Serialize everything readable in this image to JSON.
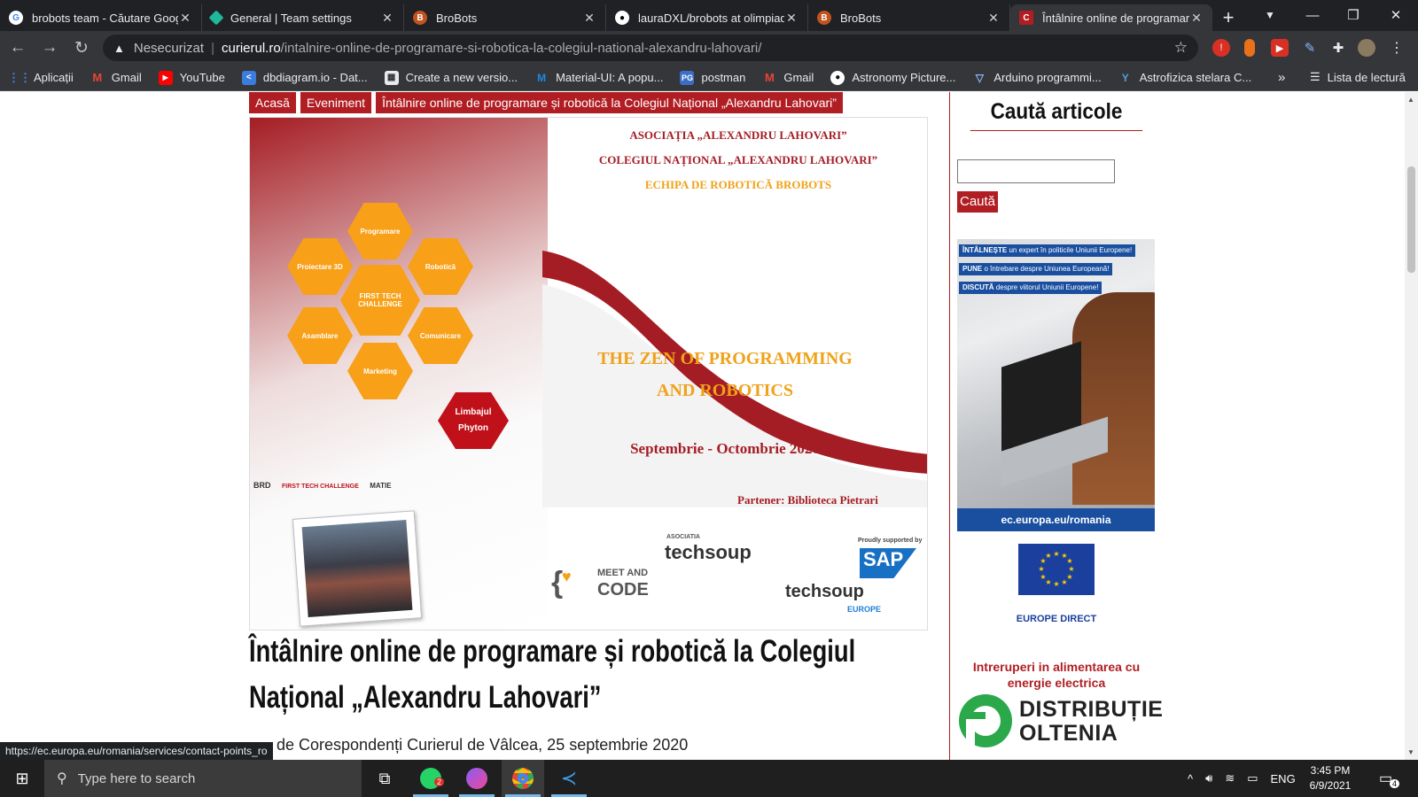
{
  "browser": {
    "tabs": [
      {
        "title": "brobots team - Căutare Google",
        "icon": "google-icon",
        "active": false
      },
      {
        "title": "General | Team settings",
        "icon": "diamond-icon",
        "active": false
      },
      {
        "title": "BroBots",
        "icon": "brobots-icon",
        "active": false
      },
      {
        "title": "lauraDXL/brobots at olimpiada",
        "icon": "github-icon",
        "active": false
      },
      {
        "title": "BroBots",
        "icon": "brobots-icon",
        "active": false
      },
      {
        "title": "Întâlnire online de programare",
        "icon": "curierul-icon",
        "active": true
      }
    ],
    "address": {
      "security": "Nesecurizat",
      "host": "curierul.ro",
      "path": "/intalnire-online-de-programare-si-robotica-la-colegiul-national-alexandru-lahovari/"
    },
    "bookmarks": [
      {
        "label": "Aplicații",
        "icon": "apps-grid-icon"
      },
      {
        "label": "Gmail",
        "icon": "gmail-icon"
      },
      {
        "label": "YouTube",
        "icon": "youtube-icon"
      },
      {
        "label": "dbdiagram.io - Dat...",
        "icon": "dbdiagram-icon"
      },
      {
        "label": "Create a new versio...",
        "icon": "grid-icon"
      },
      {
        "label": "Material-UI: A popu...",
        "icon": "material-ui-icon"
      },
      {
        "label": "postman",
        "icon": "postman-icon"
      },
      {
        "label": "Gmail",
        "icon": "gmail-icon"
      },
      {
        "label": "Astronomy Picture...",
        "icon": "astronomy-icon"
      },
      {
        "label": "Arduino programmi...",
        "icon": "arduino-icon"
      },
      {
        "label": "Astrofizica stelara C...",
        "icon": "astrofizica-icon"
      }
    ],
    "bookmarks_more": "»",
    "reading_list": "Lista de lectură",
    "status_url": "https://ec.europa.eu/romania/services/contact-points_ro"
  },
  "page": {
    "breadcrumbs": [
      "Acasă",
      "Eveniment",
      "Întâlnire online de programare și robotică la Colegiul Național „Alexandru Lahovari”"
    ],
    "poster": {
      "header1": "ASOCIAȚIA „ALEXANDRU LAHOVARI”",
      "header2": "COLEGIUL NAȚIONAL „ALEXANDRU LAHOVARI”",
      "header3": "ECHIPA DE ROBOTICĂ BROBOTS",
      "hexes": {
        "programare": "Programare",
        "proiectare": "Proiectare 3D",
        "robotica": "Robotică",
        "ftc": "FIRST TECH CHALLENGE",
        "asamblare": "Asamblare",
        "comunicare": "Comunicare",
        "marketing": "Marketing"
      },
      "python": "Limbajul Phyton",
      "zen_line1": "THE ZEN OF PROGRAMMING",
      "zen_line2": "AND ROBOTICS",
      "dates": "Septembrie - Octombrie 2020",
      "partner": "Partener: Biblioteca Pietrari",
      "logos": {
        "brd": "BRD",
        "ftc": "FIRST TECH CHALLENGE",
        "matie": "MATIE",
        "meet": "MEET AND",
        "code": "CODE",
        "asociatia": "ASOCIATIA",
        "techsoup": "techsoup",
        "proudly": "Proudly supported by",
        "sap": "SAP",
        "techsoup2": "techsoup",
        "europe": "EUROPE"
      }
    },
    "title": "Întâlnire online de programare și robotică la Colegiul Național „Alexandru Lahovari”",
    "byline": "de Corespondenți Curierul de Vâlcea, 25 septembrie 2020"
  },
  "sidebar": {
    "title": "Caută articole",
    "search_placeholder": "",
    "search_button": "Caută",
    "ad_tags": [
      {
        "bold": "ÎNTÂLNEȘTE",
        "rest": "un expert în politicile Uniunii Europene!"
      },
      {
        "bold": "PUNE",
        "rest": "o întrebare despre Uniunea Europeană!"
      },
      {
        "bold": "DISCUTĂ",
        "rest": "despre viitorul Uniunii Europene!"
      }
    ],
    "ad_footer": "ec.europa.eu/romania",
    "europe_direct": "EUROPE DIRECT",
    "power_notice": "Intreruperi in alimentarea cu energie electrica",
    "distributie_line1": "DISTRIBUȚIE",
    "distributie_line2": "OLTENIA"
  },
  "taskbar": {
    "search_placeholder": "Type here to search",
    "whatsapp_badge": "2",
    "language": "ENG",
    "time": "3:45 PM",
    "date": "6/9/2021",
    "notification_count": "4"
  },
  "colors": {
    "accent_red": "#b01e23",
    "eu_blue": "#1a3f9c",
    "orange": "#f7a018"
  }
}
